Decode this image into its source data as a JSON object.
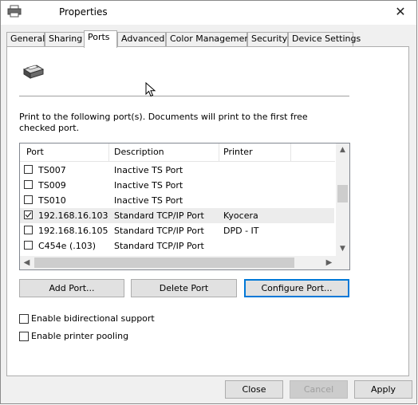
{
  "window": {
    "title": "Properties"
  },
  "tabs": [
    {
      "label": "General"
    },
    {
      "label": "Sharing"
    },
    {
      "label": "Ports",
      "active": true
    },
    {
      "label": "Advanced"
    },
    {
      "label": "Color Management"
    },
    {
      "label": "Security"
    },
    {
      "label": "Device Settings"
    }
  ],
  "ports_page": {
    "description": "Print to the following port(s). Documents will print to the first free checked port.",
    "columns": [
      "Port",
      "Description",
      "Printer"
    ],
    "rows": [
      {
        "port": "TS007",
        "description": "Inactive TS Port",
        "printer": "",
        "checked": false
      },
      {
        "port": "TS009",
        "description": "Inactive TS Port",
        "printer": "",
        "checked": false
      },
      {
        "port": "TS010",
        "description": "Inactive TS Port",
        "printer": "",
        "checked": false
      },
      {
        "port": "192.168.16.103",
        "description": "Standard TCP/IP Port",
        "printer": "Kyocera",
        "checked": true
      },
      {
        "port": "192.168.16.105",
        "description": "Standard TCP/IP Port",
        "printer": "DPD - IT",
        "checked": false
      },
      {
        "port": "C454e (.103)",
        "description": "Standard TCP/IP Port",
        "printer": "",
        "checked": false
      }
    ],
    "buttons": {
      "add": "Add Port...",
      "delete": "Delete Port",
      "configure": "Configure Port..."
    },
    "options": {
      "bidirectional": "Enable bidirectional support",
      "pooling": "Enable printer pooling"
    }
  },
  "footer": {
    "close": "Close",
    "cancel": "Cancel",
    "apply": "Apply"
  },
  "colors": {
    "focus_border": "#0078d7",
    "selected_row": "#ececec"
  }
}
